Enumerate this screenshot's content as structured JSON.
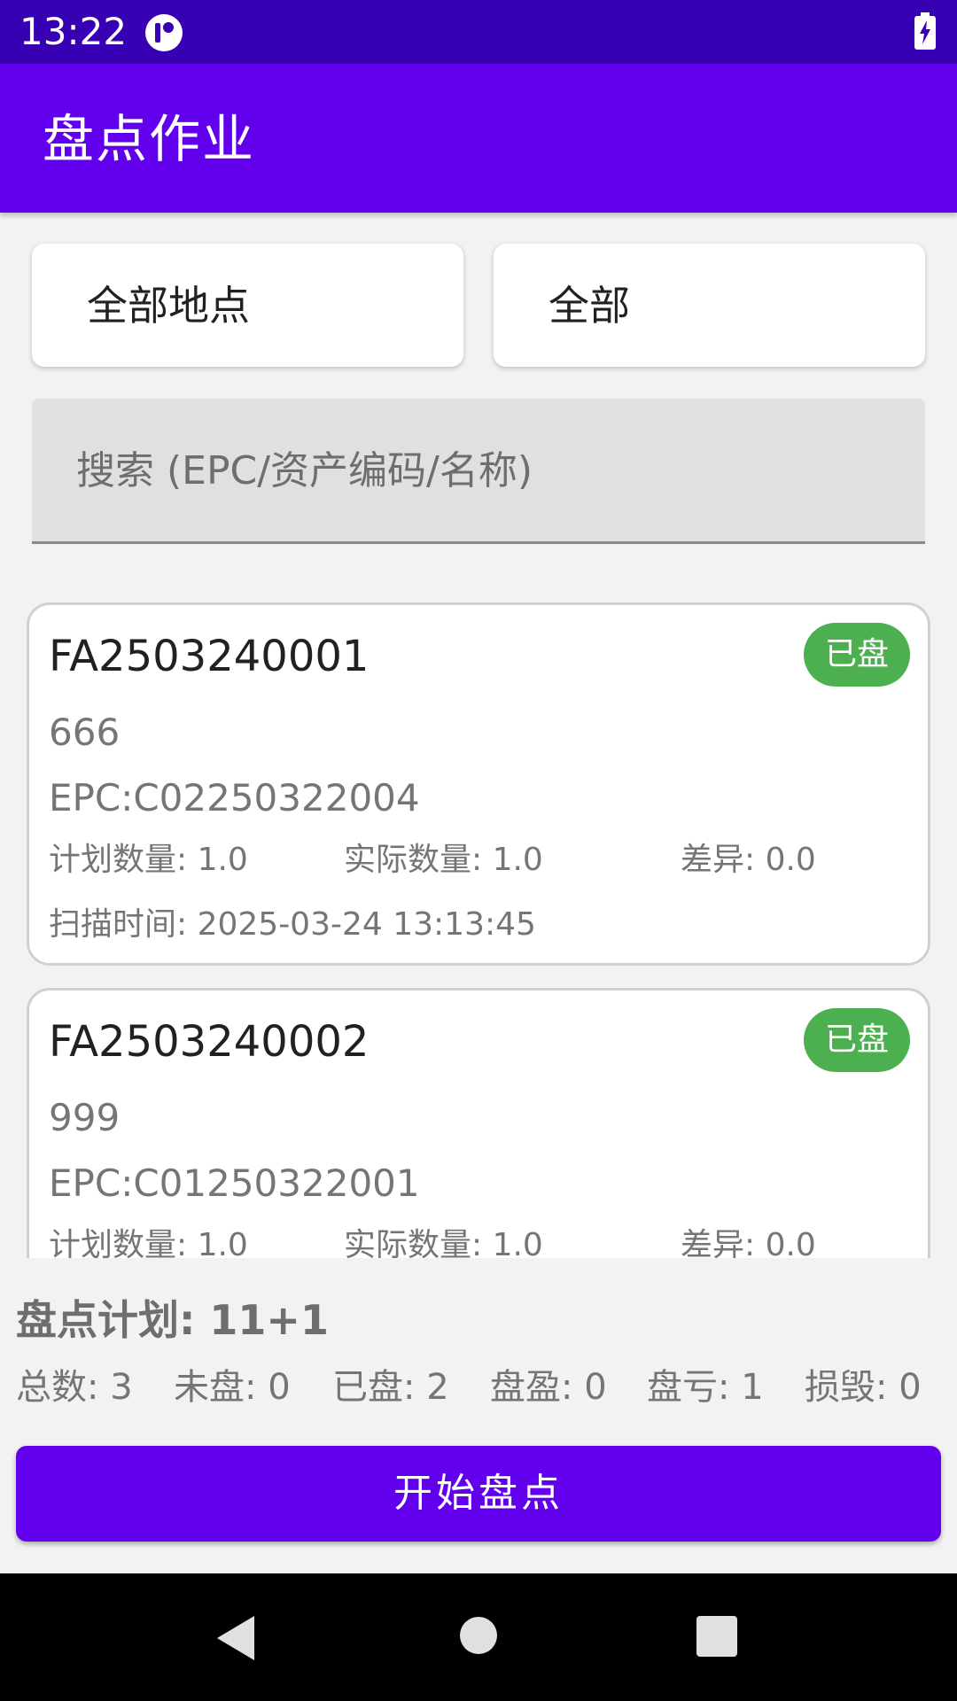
{
  "status_bar": {
    "time": "13:22"
  },
  "app_bar": {
    "title": "盘点作业"
  },
  "filters": {
    "location": "全部地点",
    "status": "全部"
  },
  "search": {
    "placeholder": "搜索 (EPC/资产编码/名称)"
  },
  "assets": [
    {
      "code": "FA2503240001",
      "status": "已盘",
      "name": "666",
      "epc": "EPC:C02250322004",
      "plan_qty": "计划数量: 1.0",
      "actual_qty": "实际数量: 1.0",
      "diff": "差异: 0.0",
      "scan_time": "扫描时间: 2025-03-24 13:13:45"
    },
    {
      "code": "FA2503240002",
      "status": "已盘",
      "name": "999",
      "epc": "EPC:C01250322001",
      "plan_qty": "计划数量: 1.0",
      "actual_qty": "实际数量: 1.0",
      "diff": "差异: 0.0",
      "scan_time": ""
    }
  ],
  "summary": {
    "title": "盘点计划: 11+1",
    "total": "总数: 3",
    "unchecked": "未盘: 0",
    "checked": "已盘: 2",
    "surplus": "盘盈: 0",
    "loss": "盘亏: 1",
    "damaged": "损毁: 0"
  },
  "actions": {
    "start_label": "开始盘点"
  },
  "colors": {
    "status_bar": "#3700b3",
    "primary": "#6200ee",
    "status_pill_checked": "#4caf50"
  },
  "icons": {
    "status_app": "app-notification-icon",
    "battery": "battery-charging-icon",
    "nav_back": "back-icon",
    "nav_home": "home-icon",
    "nav_recents": "recents-icon"
  }
}
